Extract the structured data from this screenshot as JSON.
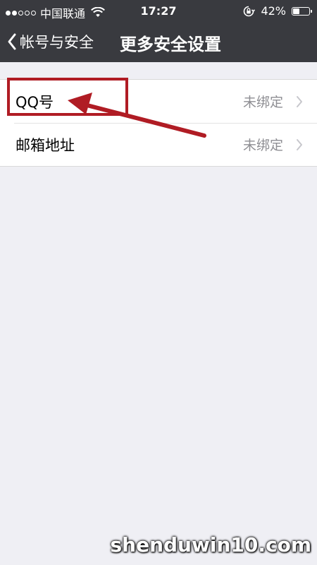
{
  "status_bar": {
    "carrier": "中国联通",
    "time": "17:27",
    "battery_text": "42%",
    "battery_level": 0.42
  },
  "navbar": {
    "back_label": "帐号与安全",
    "title": "更多安全设置"
  },
  "settings": {
    "rows": [
      {
        "label": "QQ号",
        "value": "未绑定"
      },
      {
        "label": "邮箱地址",
        "value": "未绑定"
      }
    ]
  },
  "watermark": "shenduwin10.com",
  "colors": {
    "header_bg": "#393a3f",
    "page_bg": "#efeff4",
    "annotation": "#b01c24",
    "secondary_text": "#8e8e93"
  }
}
